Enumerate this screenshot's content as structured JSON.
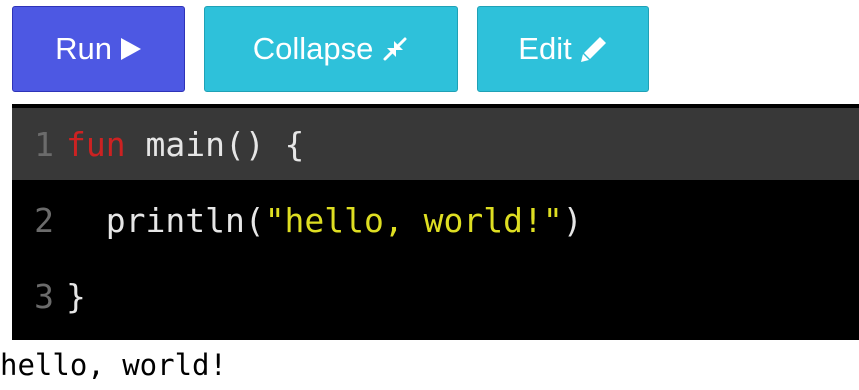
{
  "toolbar": {
    "run_label": "Run",
    "run_icon": "play-icon",
    "collapse_label": "Collapse",
    "collapse_icon": "compress-icon",
    "edit_label": "Edit",
    "edit_icon": "pencil-icon"
  },
  "editor": {
    "lines": [
      {
        "number": "1",
        "tokens": {
          "keyword": "fun",
          "rest": " main() {"
        }
      },
      {
        "number": "2",
        "tokens": {
          "indent": "  println(",
          "string": "\"hello, world!\"",
          "close": ")"
        }
      },
      {
        "number": "3",
        "tokens": {
          "rest": "}"
        }
      }
    ]
  },
  "output": {
    "text": "hello, world!"
  },
  "colors": {
    "run_button": "#4d58e3",
    "secondary_button": "#2ec1da",
    "editor_background": "#000000",
    "active_line": "#383838",
    "keyword": "#cc2222",
    "string": "#dede22"
  }
}
